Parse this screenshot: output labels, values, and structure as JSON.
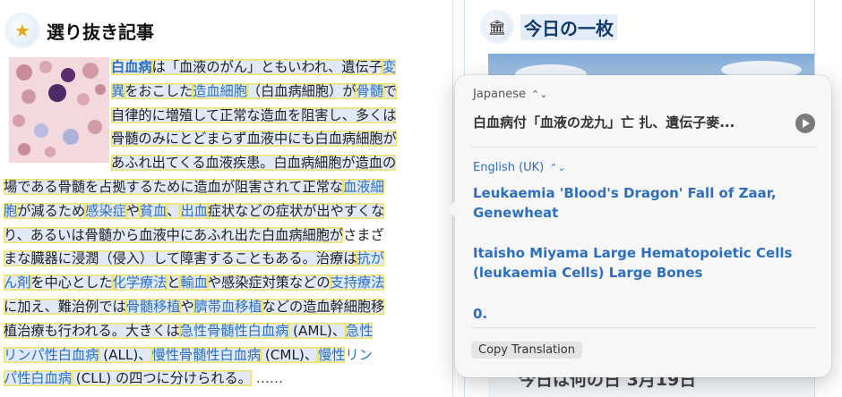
{
  "featured": {
    "title": "選り抜き記事",
    "article": {
      "l1a": "白血病",
      "l1b": "は「血液のがん」ともいわれ、遺伝子",
      "l1c": "変",
      "l2a": "異",
      "l2b": "をおこした",
      "l2c": "造血細胞",
      "l2d": "（白血病細胞）が",
      "l2e": "骨髄",
      "l2f": "で",
      "l3": "自律的に増殖して正常な造血を阻害し、多くは",
      "l4": "骨髄のみにとどまらず血液中にも白血病細胞が",
      "l5": "あふれ出てくる血液疾患。白血病細胞が造血の",
      "l6a": "場である骨髄を占拠するために造血が阻害されて正常な",
      "l6b": "血液細",
      "l7a": "胞",
      "l7b": "が減るため",
      "l7c": "感染症",
      "l7d": "や",
      "l7e": "貧血",
      "l7f": "、",
      "l7g": "出血",
      "l7h": "症状などの症状が出やすくな",
      "l8a": "り、あるいは骨髄から血液中にあふれ出た白血病細胞が",
      "l8b": "さまざ",
      "l9a": "まな臓器に浸潤（侵入）して障害することもある。治療は",
      "l9b": "抗が",
      "l10a": "ん剤",
      "l10b": "を中心とした",
      "l10c": "化学療法",
      "l10d": "と",
      "l10e": "輸血",
      "l10f": "や感染症対策などの",
      "l10g": "支持療法",
      "l11a": "に加え、難治例では",
      "l11b": "骨髄移植",
      "l11c": "や",
      "l11d": "臍帯血移植",
      "l11e": "などの造血幹細胞移",
      "l12a": "植治療も行われる。大きくは",
      "l12b": "急性骨髄性白血病",
      "l12c": " (AML)、",
      "l12d": "急性",
      "l13a": "リンパ性白血病",
      "l13b": " (ALL)、",
      "l13c": "慢性骨髄性白血病",
      "l13d": " (CML)、",
      "l13e": "慢性",
      "l13f": "リン",
      "l14a": "パ性白血病",
      "l14b": " (CLL) の四つに分けられる。",
      "l14c": "……"
    }
  },
  "picture_of_day": {
    "title": "今日の一枚"
  },
  "on_this_day": {
    "title": "今日は何の日 3月19日"
  },
  "translation_popup": {
    "source_language": "Japanese",
    "source_text": "白血病付「血液の龙九」亡 扎、遺伝子麥...",
    "target_language": "English (UK)",
    "output_1": "Leukaemia 'Blood's Dragon' Fall of Zaar, Genewheat",
    "output_2": "Itaisho Miyama Large Hematopoietic Cells (leukaemia Cells) Large Bones",
    "output_3": "0.",
    "copy_label": "Copy Translation"
  },
  "icons": {
    "featured_badge": "star-icon",
    "potd_badge": "museum-icon",
    "play": "play-icon",
    "chevron": "chevron-updown-icon"
  },
  "colors": {
    "link": "#2d6fbe",
    "highlight_fill": "#dfe9f7",
    "highlight_border": "#efe36a",
    "popup_bg": "#f7f7f7"
  }
}
